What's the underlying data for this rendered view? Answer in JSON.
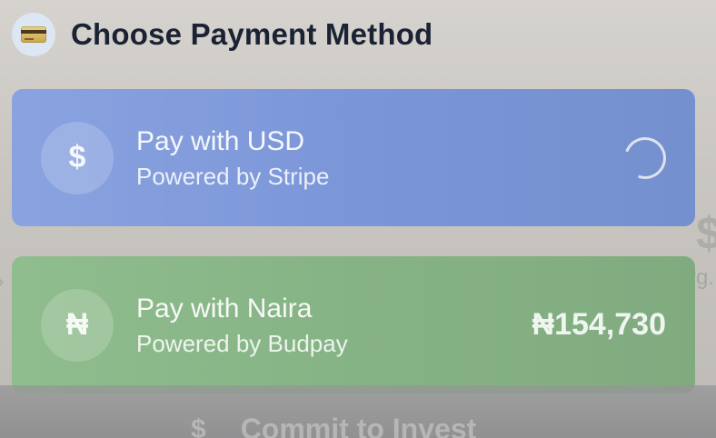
{
  "header": {
    "icon": "credit-card-icon",
    "title": "Choose Payment Method"
  },
  "options": [
    {
      "id": "usd",
      "symbol": "$",
      "icon": "dollar-icon",
      "title": "Pay with USD",
      "subtitle": "Powered by Stripe",
      "status": "loading",
      "color": "#7b96d8"
    },
    {
      "id": "naira",
      "symbol": "₦",
      "icon": "naira-icon",
      "title": "Pay with Naira",
      "subtitle": "Powered by Budpay",
      "amount": "₦154,730",
      "color": "#86b385"
    }
  ],
  "background": {
    "ghost_symbol": "$",
    "ghost_label": "Avg.",
    "chevron": "›"
  },
  "commit": {
    "icon": "$",
    "label": "Commit to Invest"
  }
}
